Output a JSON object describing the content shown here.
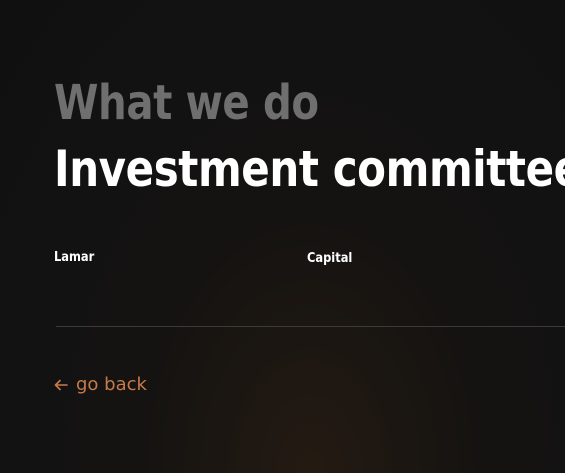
{
  "header": {
    "eyebrow": "What we do",
    "title": "Investment committee"
  },
  "tags": {
    "left": "Lamar",
    "right": "Capital"
  },
  "nav": {
    "back_label": "go back",
    "back_icon": "arrow-left-icon"
  },
  "colors": {
    "background": "#121212",
    "eyebrow": "#6f6f6f",
    "title": "#ffffff",
    "accent": "#c77a4a",
    "divider": "#3a3a3a"
  }
}
